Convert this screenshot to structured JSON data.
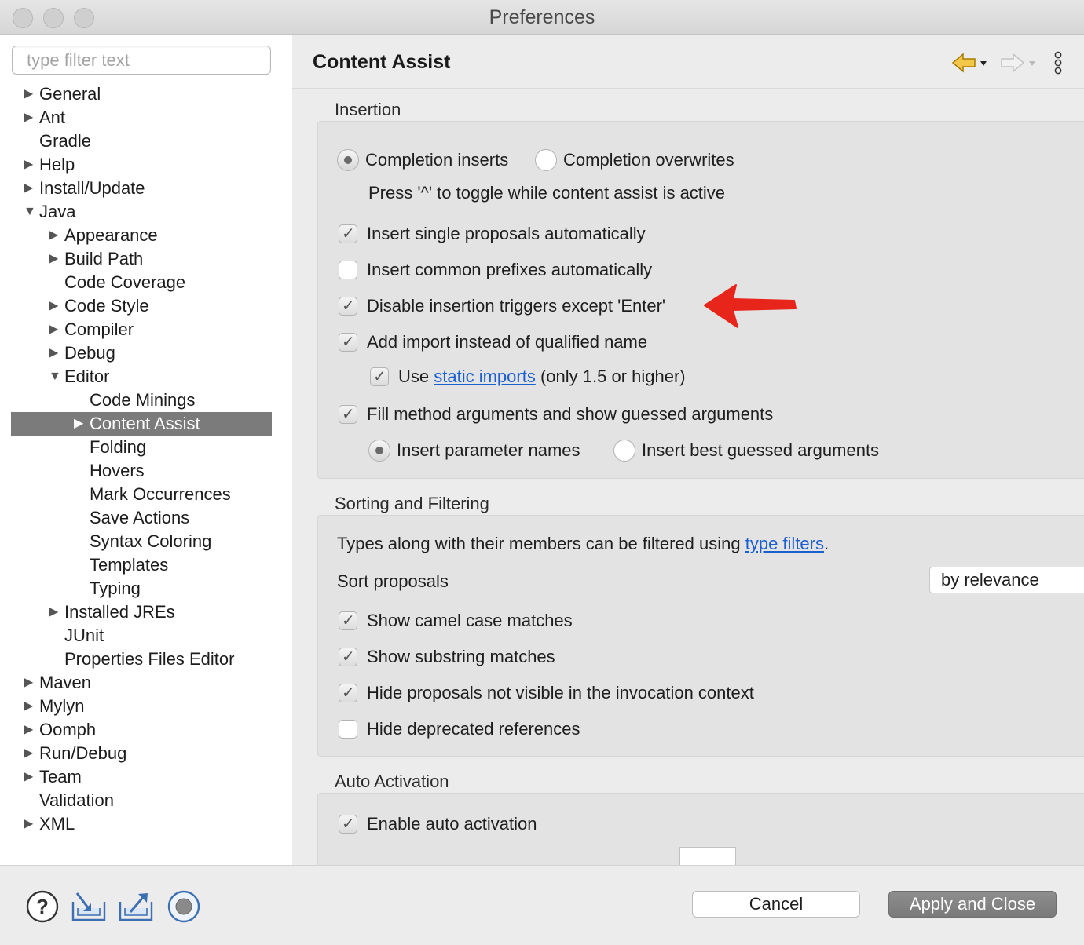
{
  "window": {
    "title": "Preferences"
  },
  "filter": {
    "placeholder": "type filter text"
  },
  "tree": [
    {
      "label": "General",
      "expander": "collapsed",
      "level": 0
    },
    {
      "label": "Ant",
      "expander": "collapsed",
      "level": 0
    },
    {
      "label": "Gradle",
      "expander": "none",
      "level": 0
    },
    {
      "label": "Help",
      "expander": "collapsed",
      "level": 0
    },
    {
      "label": "Install/Update",
      "expander": "collapsed",
      "level": 0
    },
    {
      "label": "Java",
      "expander": "expanded",
      "level": 0
    },
    {
      "label": "Appearance",
      "expander": "collapsed",
      "level": 1
    },
    {
      "label": "Build Path",
      "expander": "collapsed",
      "level": 1
    },
    {
      "label": "Code Coverage",
      "expander": "none",
      "level": 1
    },
    {
      "label": "Code Style",
      "expander": "collapsed",
      "level": 1
    },
    {
      "label": "Compiler",
      "expander": "collapsed",
      "level": 1
    },
    {
      "label": "Debug",
      "expander": "collapsed",
      "level": 1
    },
    {
      "label": "Editor",
      "expander": "expanded",
      "level": 1
    },
    {
      "label": "Code Minings",
      "expander": "none",
      "level": 2
    },
    {
      "label": "Content Assist",
      "expander": "collapsed",
      "level": 2,
      "selected": true
    },
    {
      "label": "Folding",
      "expander": "none",
      "level": 2
    },
    {
      "label": "Hovers",
      "expander": "none",
      "level": 2
    },
    {
      "label": "Mark Occurrences",
      "expander": "none",
      "level": 2
    },
    {
      "label": "Save Actions",
      "expander": "none",
      "level": 2
    },
    {
      "label": "Syntax Coloring",
      "expander": "none",
      "level": 2
    },
    {
      "label": "Templates",
      "expander": "none",
      "level": 2
    },
    {
      "label": "Typing",
      "expander": "none",
      "level": 2
    },
    {
      "label": "Installed JREs",
      "expander": "collapsed",
      "level": 1
    },
    {
      "label": "JUnit",
      "expander": "none",
      "level": 1
    },
    {
      "label": "Properties Files Editor",
      "expander": "none",
      "level": 1
    },
    {
      "label": "Maven",
      "expander": "collapsed",
      "level": 0
    },
    {
      "label": "Mylyn",
      "expander": "collapsed",
      "level": 0
    },
    {
      "label": "Oomph",
      "expander": "collapsed",
      "level": 0
    },
    {
      "label": "Run/Debug",
      "expander": "collapsed",
      "level": 0
    },
    {
      "label": "Team",
      "expander": "collapsed",
      "level": 0
    },
    {
      "label": "Validation",
      "expander": "none",
      "level": 0
    },
    {
      "label": "XML",
      "expander": "collapsed",
      "level": 0
    }
  ],
  "page": {
    "title": "Content Assist"
  },
  "insertion": {
    "label": "Insertion",
    "completion_inserts": "Completion inserts",
    "completion_overwrites": "Completion overwrites",
    "toggle_hint": "Press '^' to toggle while content assist is active",
    "insert_single": "Insert single proposals automatically",
    "insert_common": "Insert common prefixes automatically",
    "disable_triggers": "Disable insertion triggers except 'Enter'",
    "add_import": "Add import instead of qualified name",
    "use_label": "Use",
    "static_imports_link": "static imports",
    "static_imports_suffix": "(only 1.5 or higher)",
    "fill_args": "Fill method arguments and show guessed arguments",
    "insert_param_names": "Insert parameter names",
    "insert_best_guessed": "Insert best guessed arguments"
  },
  "sorting": {
    "label": "Sorting and Filtering",
    "types_prefix": "Types along with their members can be filtered using",
    "type_filters_link": "type filters",
    "types_suffix": ".",
    "sort_label": "Sort proposals",
    "sort_value": "by relevance",
    "camel_case": "Show camel case matches",
    "substring": "Show substring matches",
    "hide_not_visible": "Hide proposals not visible in the invocation context",
    "hide_deprecated": "Hide deprecated references"
  },
  "auto": {
    "label": "Auto Activation",
    "enable": "Enable auto activation"
  },
  "buttons": {
    "cancel": "Cancel",
    "apply_close": "Apply and Close"
  },
  "colors": {
    "accent_arrow": "#e8251b",
    "link": "#1a5fd0",
    "selection": "#7b7b7b",
    "nav_back": "#e6a800"
  }
}
